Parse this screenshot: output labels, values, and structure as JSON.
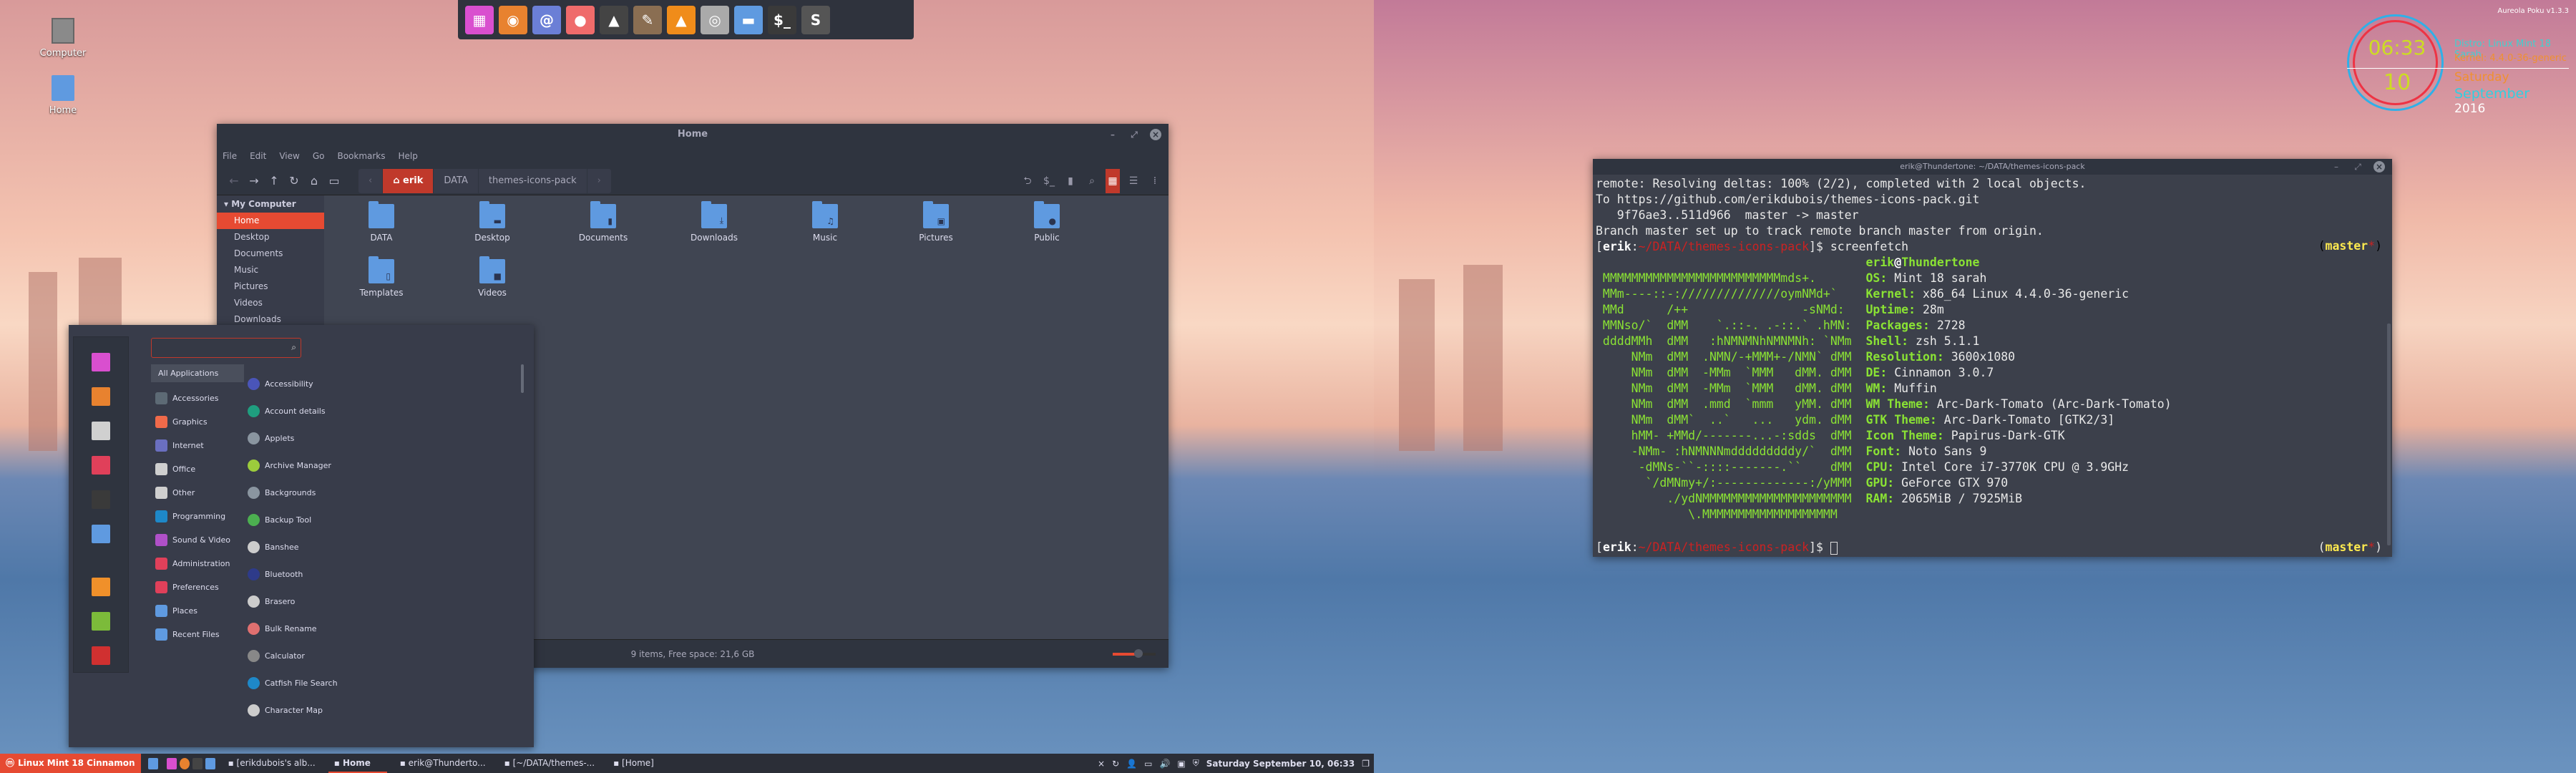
{
  "desktop": {
    "icons": [
      {
        "label": "Computer",
        "icon": "computer-icon"
      },
      {
        "label": "Home",
        "icon": "home-folder-icon"
      }
    ]
  },
  "dock": {
    "items": [
      {
        "name": "menu-grid",
        "color": "#d94fcf",
        "glyph": "▦"
      },
      {
        "name": "firefox",
        "color": "#e8822f",
        "glyph": "◉"
      },
      {
        "name": "mail",
        "color": "#6b7fd6",
        "glyph": "@"
      },
      {
        "name": "image-viewer",
        "color": "#ef6b6b",
        "glyph": "●"
      },
      {
        "name": "inkscape",
        "color": "#444",
        "glyph": "▲"
      },
      {
        "name": "gimp",
        "color": "#8a6e52",
        "glyph": "✎"
      },
      {
        "name": "vlc",
        "color": "#f08c1a",
        "glyph": "▲"
      },
      {
        "name": "video-player",
        "color": "#aaa",
        "glyph": "◎"
      },
      {
        "name": "files",
        "color": "#5f9ae0",
        "glyph": "▬"
      },
      {
        "name": "terminal",
        "color": "#3a3a3a",
        "glyph": "$_"
      },
      {
        "name": "sublime-text",
        "color": "#555",
        "glyph": "S"
      }
    ]
  },
  "file_manager": {
    "title": "Home",
    "menu": [
      "File",
      "Edit",
      "View",
      "Go",
      "Bookmarks",
      "Help"
    ],
    "breadcrumbs": [
      "erik",
      "DATA",
      "themes-icons-pack"
    ],
    "sidebar": {
      "section": "My Computer",
      "items": [
        "Home",
        "Desktop",
        "Documents",
        "Music",
        "Pictures",
        "Videos",
        "Downloads"
      ],
      "active": "Home"
    },
    "files": [
      {
        "name": "DATA",
        "badge": ""
      },
      {
        "name": "Desktop",
        "badge": "▬"
      },
      {
        "name": "Documents",
        "badge": "▮"
      },
      {
        "name": "Downloads",
        "badge": "⤓"
      },
      {
        "name": "Music",
        "badge": "♫"
      },
      {
        "name": "Pictures",
        "badge": "▣"
      },
      {
        "name": "Public",
        "badge": "●"
      },
      {
        "name": "Templates",
        "badge": "▯"
      },
      {
        "name": "Videos",
        "badge": "■"
      }
    ],
    "status": "9 items, Free space: 21,6 GB",
    "zoom_level": 0.6
  },
  "app_menu": {
    "search_placeholder": "",
    "search_value": "",
    "categories": [
      {
        "label": "All Applications",
        "color": ""
      },
      {
        "label": "Accessories",
        "color": "#5d6a75"
      },
      {
        "label": "Graphics",
        "color": "#f06a4a"
      },
      {
        "label": "Internet",
        "color": "#6a6fc0"
      },
      {
        "label": "Office",
        "color": "#cfcfcf"
      },
      {
        "label": "Other",
        "color": "#cfcfcf"
      },
      {
        "label": "Programming",
        "color": "#1e88c8"
      },
      {
        "label": "Sound & Video",
        "color": "#b050c8"
      },
      {
        "label": "Administration",
        "color": "#e0405a"
      },
      {
        "label": "Preferences",
        "color": "#e0405a"
      },
      {
        "label": "Places",
        "color": "#5f9ae0"
      },
      {
        "label": "Recent Files",
        "color": "#5f9ae0"
      }
    ],
    "apps": [
      {
        "label": "Accessibility",
        "color": "#4a55b8"
      },
      {
        "label": "Account details",
        "color": "#1f9e7f"
      },
      {
        "label": "Applets",
        "color": "#8a95a0"
      },
      {
        "label": "Archive Manager",
        "color": "#9ccc3c"
      },
      {
        "label": "Backgrounds",
        "color": "#8a95a0"
      },
      {
        "label": "Backup Tool",
        "color": "#4caf50"
      },
      {
        "label": "Banshee",
        "color": "#cccccc"
      },
      {
        "label": "Bluetooth",
        "color": "#2e3b8a"
      },
      {
        "label": "Brasero",
        "color": "#cccccc"
      },
      {
        "label": "Bulk Rename",
        "color": "#e07070"
      },
      {
        "label": "Calculator",
        "color": "#888888"
      },
      {
        "label": "Catfish File Search",
        "color": "#1e88c8"
      },
      {
        "label": "Character Map",
        "color": "#cccccc"
      }
    ],
    "favorites": [
      {
        "name": "menu-grid",
        "color": "#d94fcf"
      },
      {
        "name": "firefox",
        "color": "#e8822f"
      },
      {
        "name": "software-manager",
        "color": "#d0d0d0"
      },
      {
        "name": "system-settings",
        "color": "#e0405a"
      },
      {
        "name": "terminal",
        "color": "#3a3a3a"
      },
      {
        "name": "files",
        "color": "#5f9ae0"
      },
      {
        "name": "lock-screen",
        "color": "#f0902a"
      },
      {
        "name": "download",
        "color": "#7cbb3a"
      },
      {
        "name": "shutdown",
        "color": "#d03030"
      }
    ]
  },
  "terminal": {
    "title": "erik@Thundertone: ~/DATA/themes-icons-pack",
    "lines": [
      "remote: Resolving deltas: 100% (2/2), completed with 2 local objects.",
      "To https://github.com/erikdubois/themes-icons-pack.git",
      "   9f76ae3..511d966  master -> master",
      "Branch master set up to track remote branch master from origin."
    ],
    "prompt_user": "erik",
    "prompt_path": "~/DATA/themes-icons-pack",
    "command": "screenfetch",
    "branch": "master",
    "logo": [
      "                                 ",
      " MMMMMMMMMMMMMMMMMMMMMMMMMmds+.  ",
      " MMm----::-://////////////oymNMd+`",
      " MMd      /++                -sNMd:",
      " MMNso/`  dMM    `.::-. .-::.` .hMN:",
      " ddddMMh  dMM   :hNMNMNhNMNMNh: `NMm",
      "     NMm  dMM  .NMN/-+MMM+-/NMN` dMM",
      "     NMm  dMM  -MMm  `MMM   dMM. dMM",
      "     NMm  dMM  -MMm  `MMM   dMM. dMM",
      "     NMm  dMM  .mmd  `mmm   yMM. dMM",
      "     NMm  dMM`  ..`   ...   ydm. dMM",
      "     hMM- +MMd/-------...-:sdds  dMM",
      "     -NMm- :hNMNNNmdddddddddy/`  dMM",
      "      -dMNs-``-::::-------.``    dMM",
      "       `/dMNmy+/:-------------:/yMMM",
      "          ./ydNMMMMMMMMMMMMMMMMMMMMM",
      "             \\.MMMMMMMMMMMMMMMMMMM"
    ],
    "info_header": {
      "user": "erik",
      "host": "Thundertone"
    },
    "info": [
      {
        "key": "OS:",
        "value": "Mint 18 sarah"
      },
      {
        "key": "Kernel:",
        "value": "x86_64 Linux 4.4.0-36-generic"
      },
      {
        "key": "Uptime:",
        "value": "28m"
      },
      {
        "key": "Packages:",
        "value": "2728"
      },
      {
        "key": "Shell:",
        "value": "zsh 5.1.1"
      },
      {
        "key": "Resolution:",
        "value": "3600x1080"
      },
      {
        "key": "DE:",
        "value": "Cinnamon 3.0.7"
      },
      {
        "key": "WM:",
        "value": "Muffin"
      },
      {
        "key": "WM Theme:",
        "value": "Arc-Dark-Tomato (Arc-Dark-Tomato)"
      },
      {
        "key": "GTK Theme:",
        "value": "Arc-Dark-Tomato [GTK2/3]"
      },
      {
        "key": "Icon Theme:",
        "value": "Papirus-Dark-GTK"
      },
      {
        "key": "Font:",
        "value": "Noto Sans 9"
      },
      {
        "key": "CPU:",
        "value": "Intel Core i7-3770K CPU @ 3.9GHz"
      },
      {
        "key": "GPU:",
        "value": "GeForce GTX 970"
      },
      {
        "key": "RAM:",
        "value": "2065MiB / 7925MiB"
      }
    ]
  },
  "conky": {
    "title": "Aureola Poku v1.3.3",
    "time": "06:33",
    "day": "10",
    "distro": "Distro: Linux Mint 18 Sarah",
    "kernel": "Kernel: 4.4.0-36-generic",
    "weekday": "Saturday",
    "month": "September",
    "year": "2016"
  },
  "taskbar": {
    "menu_label": "Linux Mint 18 Cinnamon",
    "tasks": [
      {
        "label": "[erikdubois's alb...",
        "icon": "firefox-icon",
        "active": false
      },
      {
        "label": "Home",
        "icon": "folder-icon",
        "active": true
      },
      {
        "label": "erik@Thunderto...",
        "icon": "terminal-icon",
        "active": false
      },
      {
        "label": "[~/DATA/themes-...",
        "icon": "sublime-icon",
        "active": false
      },
      {
        "label": "[Home]",
        "icon": "folder-icon",
        "active": false
      }
    ],
    "clock": "Saturday September 10, 06:33"
  },
  "colors": {
    "accent": "#e64a32",
    "panel": "#2f343f",
    "window": "#404552"
  }
}
